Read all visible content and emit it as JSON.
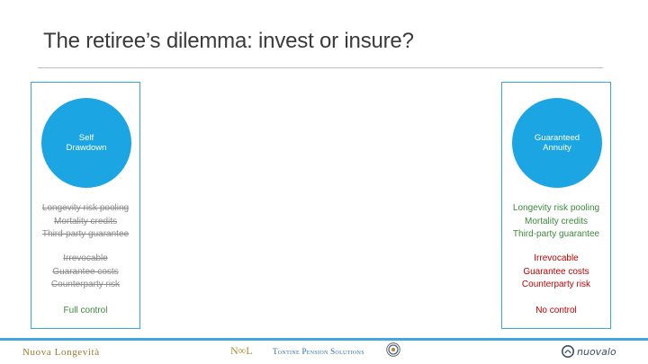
{
  "slide": {
    "title": "The retiree’s dilemma:  invest or insure?"
  },
  "left_option": {
    "circle_label": "Self\nDrawdown",
    "benefits": [
      "Longevity risk pooling",
      "Mortality credits",
      "Third-party guarantee"
    ],
    "risks": [
      "Irrevocable",
      "Guarantee costs",
      "Counterparty risk"
    ],
    "control": "Full control"
  },
  "right_option": {
    "circle_label": "Guaranteed\nAnnuity",
    "benefits": [
      "Longevity risk pooling",
      "Mortality credits",
      "Third-party guarantee"
    ],
    "risks": [
      "Irrevocable",
      "Guarantee costs",
      "Counterparty risk"
    ],
    "control": "No control"
  },
  "footer": {
    "logo_nuova": "Nuova Longevità",
    "logo_nl": "N∞L",
    "tontine": "Tontine Pension Solutions",
    "nuovalo": "nuovalo"
  },
  "colors": {
    "accent_blue": "#1ba6e3",
    "benefit_green": "#3b8a3b",
    "risk_red": "#c00000",
    "struck_gray": "#8c8c8c"
  }
}
